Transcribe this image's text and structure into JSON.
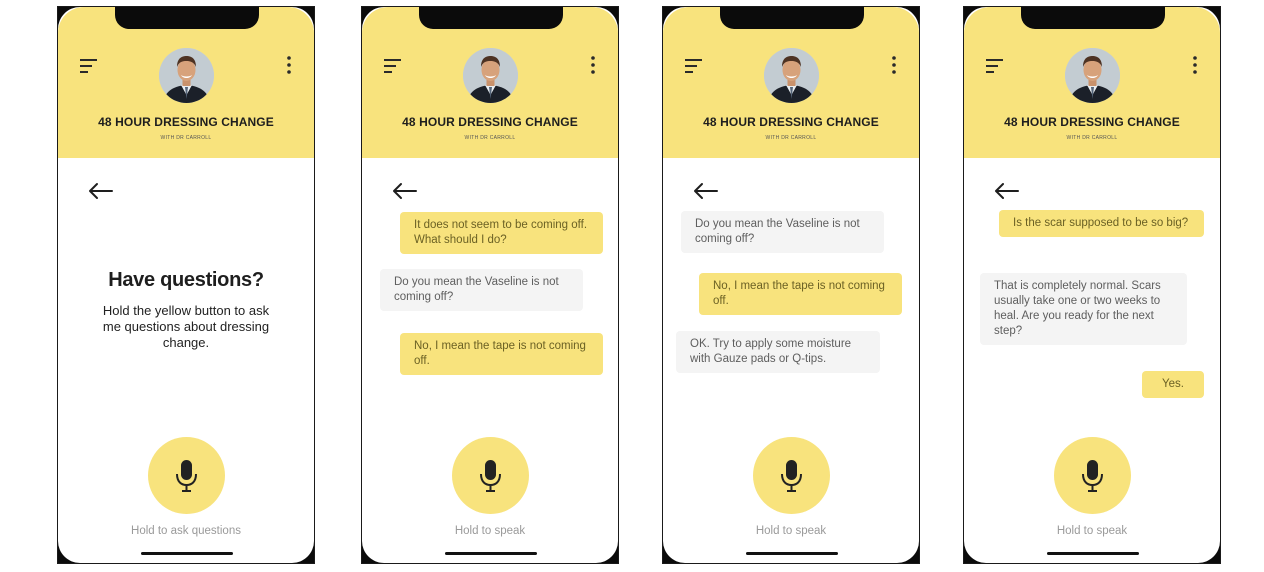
{
  "header": {
    "title": "48 HOUR DRESSING CHANGE",
    "subtitle": "WITH DR CARROLL"
  },
  "colors": {
    "accent_yellow": "#f8e37d",
    "bot_bubble": "#f4f4f4",
    "user_text": "#6b6124",
    "hint_text": "#9a9a9a"
  },
  "icons": {
    "menu": "hamburger-menu-icon",
    "more": "vertical-ellipsis-icon",
    "back": "left-arrow-icon",
    "mic": "microphone-icon"
  },
  "screens": [
    {
      "heading": "Have questions?",
      "body": "Hold the yellow button to ask me questions about dressing change.",
      "hint": "Hold to ask questions",
      "messages": []
    },
    {
      "hint": "Hold to speak",
      "messages": [
        {
          "role": "user",
          "text": "It does not seem to be coming off. What should I do?"
        },
        {
          "role": "bot",
          "text": "Do you mean the Vaseline is not coming off?"
        },
        {
          "role": "user",
          "text": "No, I mean the tape is not coming off."
        }
      ]
    },
    {
      "hint": "Hold to speak",
      "messages": [
        {
          "role": "bot",
          "text": "Do you mean the Vaseline is not coming off?"
        },
        {
          "role": "user",
          "text": "No, I mean the tape is not coming off."
        },
        {
          "role": "bot",
          "text": "OK. Try to apply some moisture with Gauze pads or Q-tips."
        }
      ]
    },
    {
      "hint": "Hold to speak",
      "messages": [
        {
          "role": "user",
          "text": "Is the scar supposed to be so big?"
        },
        {
          "role": "bot",
          "text": "That is completely normal. Scars usually take one or two weeks to heal. Are you ready for the next step?"
        },
        {
          "role": "user",
          "text": "Yes."
        }
      ]
    }
  ]
}
